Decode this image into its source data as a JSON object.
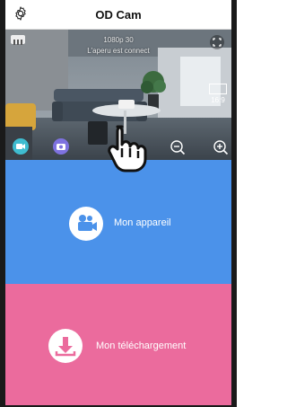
{
  "header": {
    "title": "OD Cam",
    "settings_icon": "gear-icon"
  },
  "preview": {
    "fps_text": "1080p 30",
    "status_text": "L'aperu est connect",
    "aspect_ratio": "16:9",
    "controls": {
      "record_icon": "video-record-icon",
      "snapshot_icon": "camera-snapshot-icon",
      "zoom_out_icon": "zoom-out-icon",
      "zoom_in_icon": "zoom-in-icon",
      "fullscreen_icon": "fullscreen-icon",
      "quality_icon": "hd-badge-icon"
    }
  },
  "menu": {
    "device_label": "Mon appareil",
    "device_icon": "video-camera-icon",
    "download_label": "Mon téléchargement",
    "download_icon": "download-icon"
  },
  "colors": {
    "device_tile": "#4b92ea",
    "download_tile": "#eb6b9d",
    "record_button": "#3fbcd0",
    "snapshot_button": "#7e72e0",
    "record_dot": "#e23c3c"
  }
}
